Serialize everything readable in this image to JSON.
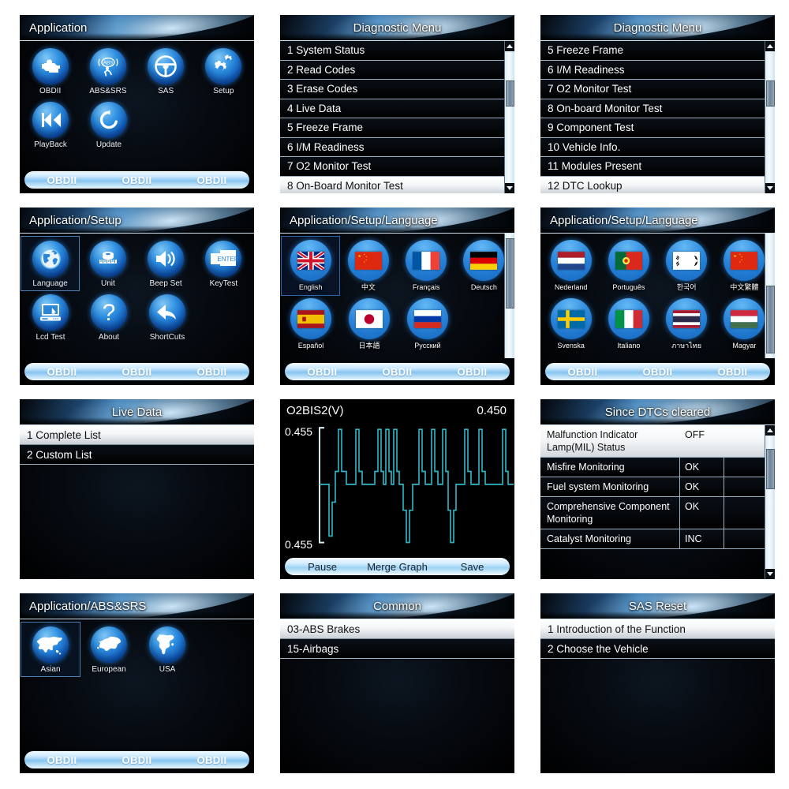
{
  "panels": {
    "application": {
      "title": "Application",
      "icons": [
        {
          "label": "OBDII",
          "icon": "engine-icon"
        },
        {
          "label": "ABS&SRS",
          "icon": "abs-srs-icon"
        },
        {
          "label": "SAS",
          "icon": "steering-wheel-icon"
        },
        {
          "label": "Setup",
          "icon": "gears-icon"
        },
        {
          "label": "PlayBack",
          "icon": "rewind-icon"
        },
        {
          "label": "Update",
          "icon": "refresh-icon"
        }
      ],
      "bottom_bar": [
        "OBDII",
        "OBDII",
        "OBDII"
      ]
    },
    "diagnostic_menu_1": {
      "title": "Diagnostic Menu",
      "items": [
        {
          "label": "1 System Status",
          "selected": false
        },
        {
          "label": "2 Read Codes",
          "selected": false
        },
        {
          "label": "3 Erase Codes",
          "selected": false
        },
        {
          "label": "4 Live  Data",
          "selected": false
        },
        {
          "label": "5 Freeze Frame",
          "selected": false
        },
        {
          "label": "6 I/M Readiness",
          "selected": false
        },
        {
          "label": "7 O2 Monitor  Test",
          "selected": false
        },
        {
          "label": "8 On-Board Monitor Test",
          "selected": true
        }
      ]
    },
    "diagnostic_menu_2": {
      "title": "Diagnostic Menu",
      "items": [
        {
          "label": "5 Freeze Frame",
          "selected": false
        },
        {
          "label": "6 I/M Readiness",
          "selected": false
        },
        {
          "label": "7 O2 Monitor  Test",
          "selected": false
        },
        {
          "label": "8 On-board Monitor Test",
          "selected": false
        },
        {
          "label": "9 Component Test",
          "selected": false
        },
        {
          "label": "10 Vehicle Info.",
          "selected": false
        },
        {
          "label": "11 Modules Present",
          "selected": false
        },
        {
          "label": "12 DTC Lookup",
          "selected": true
        }
      ]
    },
    "setup": {
      "title": "Application/Setup",
      "icons": [
        {
          "label": "Language",
          "icon": "globe-icon",
          "selected": true
        },
        {
          "label": "Unit",
          "icon": "measuring-tape-icon",
          "selected": false
        },
        {
          "label": "Beep Set",
          "icon": "speaker-icon",
          "selected": false
        },
        {
          "label": "KeyTest",
          "icon": "enter-key-icon",
          "selected": false
        },
        {
          "label": "Lcd Test",
          "icon": "monitor-icon",
          "selected": false
        },
        {
          "label": "About",
          "icon": "question-mark-icon",
          "selected": false
        },
        {
          "label": "ShortCuts",
          "icon": "back-arrow-icon",
          "selected": false
        }
      ],
      "bottom_bar": [
        "OBDII",
        "OBDII",
        "OBDII"
      ]
    },
    "language_1": {
      "title": "Application/Setup/Language",
      "languages": [
        {
          "label": "English",
          "flag": "uk-flag-icon",
          "selected": true
        },
        {
          "label": "中文",
          "flag": "china-flag-icon",
          "selected": false
        },
        {
          "label": "Français",
          "flag": "france-flag-icon",
          "selected": false
        },
        {
          "label": "Deutsch",
          "flag": "germany-flag-icon",
          "selected": false
        },
        {
          "label": "Español",
          "flag": "spain-flag-icon",
          "selected": false
        },
        {
          "label": "日本語",
          "flag": "japan-flag-icon",
          "selected": false
        },
        {
          "label": "Pусский",
          "flag": "russia-flag-icon",
          "selected": false
        }
      ],
      "bottom_bar": [
        "OBDII",
        "OBDII",
        "OBDII"
      ]
    },
    "language_2": {
      "title": "Application/Setup/Language",
      "languages": [
        {
          "label": "Nederland",
          "flag": "netherlands-flag-icon",
          "selected": false
        },
        {
          "label": "Português",
          "flag": "portugal-flag-icon",
          "selected": false
        },
        {
          "label": "한국어",
          "flag": "korea-flag-icon",
          "selected": false
        },
        {
          "label": "中文繁體",
          "flag": "china-flag-icon",
          "selected": false
        },
        {
          "label": "Svenska",
          "flag": "sweden-flag-icon",
          "selected": false
        },
        {
          "label": "Italiano",
          "flag": "italy-flag-icon",
          "selected": false
        },
        {
          "label": "ภาษาไทย",
          "flag": "thailand-flag-icon",
          "selected": false
        },
        {
          "label": "Magyar",
          "flag": "hungary-flag-icon",
          "selected": false
        }
      ],
      "bottom_bar": [
        "OBDII",
        "OBDII",
        "OBDII"
      ]
    },
    "live_data": {
      "title": "Live Data",
      "items": [
        {
          "label": "1 Complete List",
          "selected": true
        },
        {
          "label": "2 Custom List",
          "selected": false
        }
      ]
    },
    "graph": {
      "pid_label": "O2BIS2(V)",
      "current_value": "0.450",
      "y_max_label": "0.455",
      "y_min_label": "0.455",
      "buttons": [
        "Pause",
        "Merge Graph",
        "Save"
      ],
      "trace_color": "#2fb8c8"
    },
    "since_dtcs_cleared": {
      "title": "Since DTCs cleared",
      "rows": [
        {
          "name": "Malfunction Indicator Lamp(MIL) Status",
          "value": "OFF",
          "selected": true
        },
        {
          "name": "Misfire Monitoring",
          "value": "OK",
          "selected": false
        },
        {
          "name": "Fuel system Monitoring",
          "value": "OK",
          "selected": false
        },
        {
          "name": "Comprehensive Component Monitoring",
          "value": "OK",
          "selected": false
        },
        {
          "name": "Catalyst Monitoring",
          "value": "INC",
          "selected": false
        }
      ]
    },
    "abs_srs": {
      "title": "Application/ABS&SRS",
      "regions": [
        {
          "label": "Asian",
          "icon": "asia-map-icon",
          "selected": true
        },
        {
          "label": "European",
          "icon": "europe-map-icon",
          "selected": false
        },
        {
          "label": "USA",
          "icon": "north-america-map-icon",
          "selected": false
        }
      ],
      "bottom_bar": [
        "OBDII",
        "OBDII",
        "OBDII"
      ]
    },
    "common": {
      "title": "Common",
      "items": [
        {
          "label": "03-ABS Brakes",
          "selected": true
        },
        {
          "label": "15-Airbags",
          "selected": false
        }
      ]
    },
    "sas_reset": {
      "title": "SAS Reset",
      "items": [
        {
          "label": "1 Introduction of the Function",
          "selected": true
        },
        {
          "label": "2 Choose the Vehicle",
          "selected": false
        }
      ]
    }
  },
  "chart_data": {
    "type": "line",
    "title": "O2BIS2(V)",
    "ylabel": "",
    "xlabel": "",
    "ylim": [
      0.455,
      0.455
    ],
    "current_value": 0.45,
    "grid": false,
    "series": [
      {
        "name": "O2BIS2(V)",
        "description": "Oxygen sensor bank1 sensor2 voltage square-wave trace with high spikes and downward dips",
        "values": [
          0.45,
          0.45,
          0.45,
          0.45,
          0.45,
          0.455,
          0.38,
          0.3,
          0.44,
          0.455,
          0.455,
          0.45,
          0.45,
          0.455,
          0.455,
          0.45,
          0.45,
          0.455,
          0.455,
          0.455,
          0.45,
          0.45,
          0.455,
          0.455,
          0.45,
          0.455,
          0.455,
          0.45,
          0.45,
          0.455,
          0.455,
          0.45,
          0.3,
          0.44,
          0.45,
          0.455,
          0.455,
          0.45,
          0.455,
          0.455,
          0.45,
          0.38,
          0.31,
          0.45,
          0.455,
          0.455,
          0.45,
          0.455,
          0.455,
          0.45,
          0.45,
          0.455,
          0.45
        ]
      }
    ]
  }
}
